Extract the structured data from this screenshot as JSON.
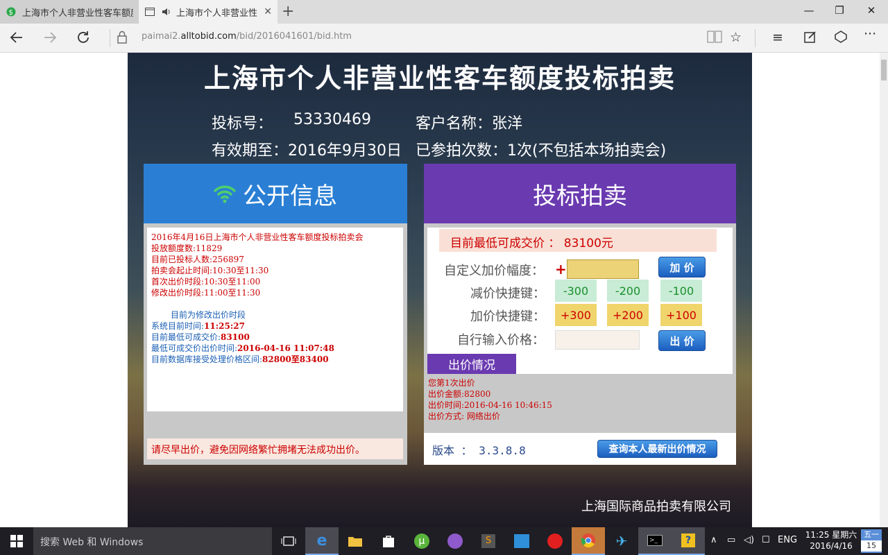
{
  "browser": {
    "tabs": [
      {
        "title": "上海市个人非营业性客车额度"
      },
      {
        "title": "上海市个人非营业性"
      }
    ],
    "url_prefix": "paimai2.",
    "url_domain": "alltobid.com",
    "url_path": "/bid/2016041601/bid.htm"
  },
  "page": {
    "title": "上海市个人非营业性客车额度投标拍卖",
    "bid_no_label": "投标号：",
    "bid_no": "53330469",
    "customer_label": "客户名称：张洋",
    "valid_until": "有效期至：2016年9月30日",
    "participation": "已参拍次数：1次(不包括本场拍卖会)",
    "public_info_title": "公开信息",
    "auction_title": "投标拍卖",
    "public_info": {
      "line1": "2016年4月16日上海市个人非营业性客车额度投标拍卖会",
      "line2": "投放额度数:11829",
      "line3": "目前已投标人数:256897",
      "line4": "拍卖会起止时间:10:30至11:30",
      "line5": "首次出价时段:10:30至11:00",
      "line6": "修改出价时段:11:00至11:30",
      "phase": "目前为修改出价时段",
      "sys_time_label": "系统目前时间:",
      "sys_time": "11:25:27",
      "min_price_label": "目前最低可成交价:",
      "min_price": "83100",
      "min_price_time_label": "最低可成交价出价时间:",
      "min_price_time": "2016-04-16 11:07:48",
      "range_label": "目前数据库接受处理价格区间:",
      "range": "82800至83400"
    },
    "notice": "请尽早出价，避免因网络繁忙拥堵无法成功出价。",
    "current_min": "目前最低可成交价 ： 83100元",
    "custom_inc_label": "自定义加价幅度：",
    "plus_sign": "+",
    "add_btn": "加 价",
    "dec_label": "减价快捷键：",
    "dec_buttons": [
      "-300",
      "-200",
      "-100"
    ],
    "inc_label": "加价快捷键：",
    "inc_buttons": [
      "+300",
      "+200",
      "+100"
    ],
    "self_input_label": "自行输入价格：",
    "bid_btn": "出 价",
    "bid_status_tab": "出价情况",
    "bid_status": {
      "line1": "您第1次出价",
      "line2": "出价金额:82800",
      "line3": "出价时间:2016-04-16 10:46:15",
      "line4": "出价方式: 网络出价"
    },
    "version": "版本 ： 3.3.8.8",
    "query_btn": "查询本人最新出价情况",
    "company": "上海国际商品拍卖有限公司"
  },
  "taskbar": {
    "search_placeholder": "搜索 Web 和 Windows",
    "lang": "ENG",
    "time": "11:25 星期六",
    "date": "2016/4/16",
    "cal_day_name": "五一",
    "cal_day": "15"
  }
}
